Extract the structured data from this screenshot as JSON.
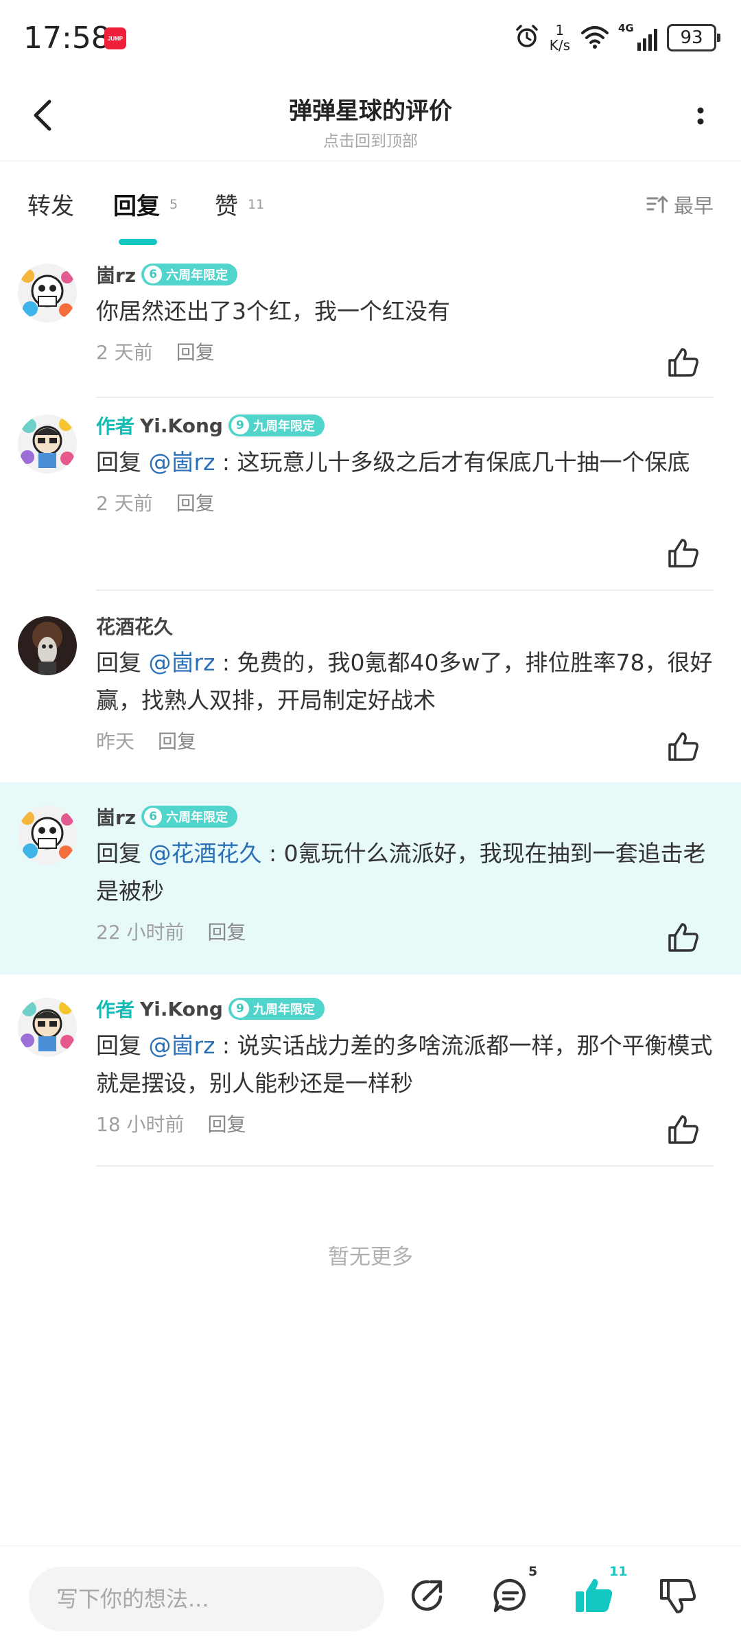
{
  "status_bar": {
    "time": "17:58",
    "app_icon_text": "JUMP",
    "speed_value": "1",
    "speed_unit": "K/s",
    "network_type": "4G",
    "battery": "93"
  },
  "header": {
    "title": "弹弹星球的评价",
    "subtitle": "点击回到顶部"
  },
  "tabs": [
    {
      "label": "转发",
      "count": ""
    },
    {
      "label": "回复",
      "count": "5"
    },
    {
      "label": "赞",
      "count": "11"
    }
  ],
  "sort_label": "最早",
  "reply_label": "回复",
  "author_label": "作者",
  "comments": [
    {
      "name": "崮rz",
      "badge": "六周年限定",
      "badge_icon": "6",
      "is_author": false,
      "prefix": "",
      "mention": "",
      "text": "你居然还出了3个红，我一个红没有",
      "time": "2 天前",
      "highlighted": false
    },
    {
      "name": "Yi.Kong",
      "badge": "九周年限定",
      "badge_icon": "9",
      "is_author": true,
      "prefix": "回复 ",
      "mention": "@崮rz",
      "text": " : 这玩意儿十多级之后才有保底几十抽一个保底",
      "time": "2 天前",
      "highlighted": false
    },
    {
      "name": "花酒花久",
      "badge": "",
      "badge_icon": "",
      "is_author": false,
      "prefix": "回复 ",
      "mention": "@崮rz",
      "text": " : 免费的，我0氪都40多w了，排位胜率78，很好赢，找熟人双排，开局制定好战术",
      "time": "昨天",
      "highlighted": false
    },
    {
      "name": "崮rz",
      "badge": "六周年限定",
      "badge_icon": "6",
      "is_author": false,
      "prefix": "回复 ",
      "mention": "@花酒花久",
      "text": " : 0氪玩什么流派好，我现在抽到一套追击老是被秒",
      "time": "22 小时前",
      "highlighted": true
    },
    {
      "name": "Yi.Kong",
      "badge": "九周年限定",
      "badge_icon": "9",
      "is_author": true,
      "prefix": "回复 ",
      "mention": "@崮rz",
      "text": " : 说实话战力差的多啥流派都一样，那个平衡模式就是摆设，别人能秒还是一样秒",
      "time": "18 小时前",
      "highlighted": false
    }
  ],
  "no_more_text": "暂无更多",
  "bottom_bar": {
    "input_placeholder": "写下你的想法...",
    "comment_count": "5",
    "like_count": "11"
  },
  "colors": {
    "accent": "#13bdb6",
    "mention": "#2a70b6",
    "highlight_bg": "#e7f9f8",
    "badge_bg": "#50d4cc"
  }
}
